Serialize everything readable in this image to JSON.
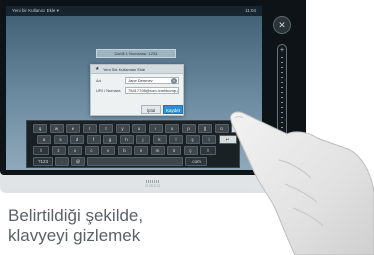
{
  "status_bar": {
    "left": "Yeni bir Kullanıcı Ekle  ▾",
    "right": "11:04"
  },
  "call_box": {
    "text": "Dahili 1 Numarası: 1234"
  },
  "dialog": {
    "title": "Yeni Sık Kullanılan Ekle",
    "name_label": "Ad",
    "name_value": "Jane Demnev",
    "uri_label": "URI / Numara",
    "uri_value": "75417798@rom.icmhkomp.com",
    "cancel_label": "İptal",
    "save_label": "Kaydet"
  },
  "keyboard": {
    "row1": [
      "q",
      "w",
      "e",
      "r",
      "t",
      "y",
      "u",
      "ı",
      "o",
      "p",
      "ğ",
      "ü"
    ],
    "row2": [
      "a",
      "s",
      "d",
      "f",
      "g",
      "h",
      "j",
      "k",
      "l",
      "ş",
      "i"
    ],
    "row3": [
      "z",
      "x",
      "c",
      "v",
      "b",
      "n",
      "m",
      "ö",
      "ç"
    ],
    "row4": [
      "?123",
      ".",
      "@",
      ".com"
    ],
    "backspace_label": "⌫",
    "shift_label": "⇧",
    "hide_label": "⌨",
    "enter_label": "↵"
  },
  "side_panel": {
    "mute_icon": "mic-mute-icon",
    "volume_plus": "+"
  },
  "device": {
    "logo_text": "CISCO"
  },
  "caption": {
    "line1": "Belirtildiği şekilde,",
    "line2": "klavyeyi gizlemek"
  }
}
